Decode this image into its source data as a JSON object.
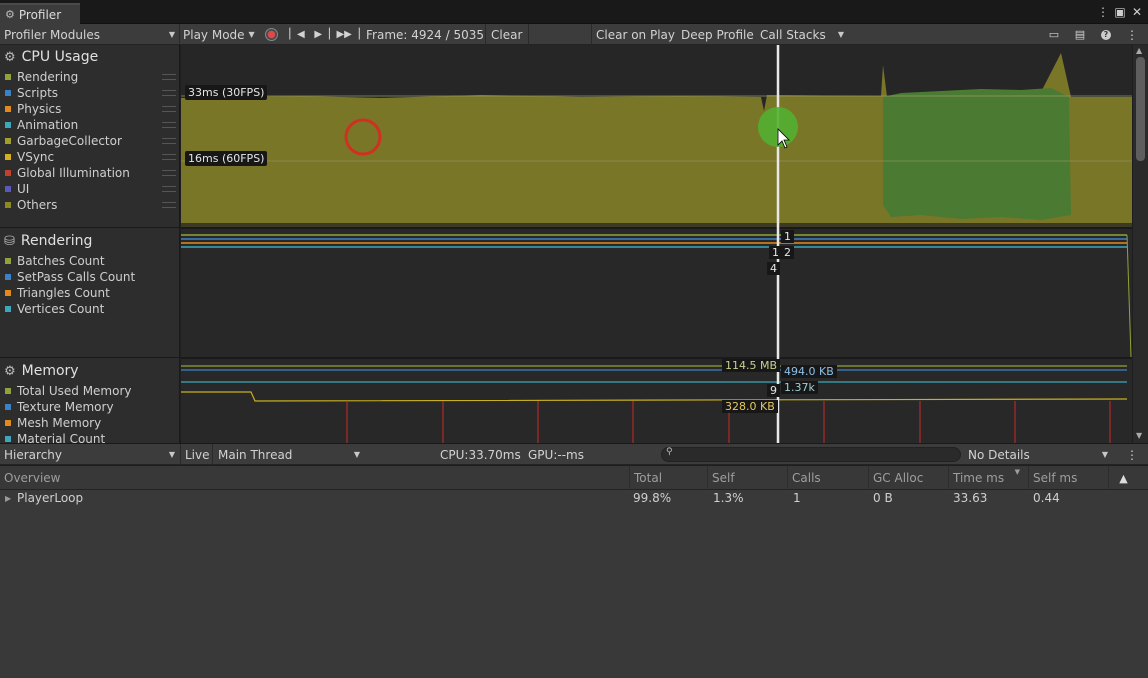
{
  "window": {
    "tab_title": "Profiler"
  },
  "toolbar": {
    "modules_label": "Profiler Modules",
    "play_mode_label": "Play Mode",
    "frame_label": "Frame: 4924 / 5035",
    "clear_label": "Clear",
    "clear_on_play_label": "Clear on Play",
    "deep_profile_label": "Deep Profile",
    "call_stacks_label": "Call Stacks"
  },
  "modules": {
    "cpu": {
      "title": "CPU Usage",
      "items": [
        {
          "label": "Rendering",
          "color": "#8fa33a"
        },
        {
          "label": "Scripts",
          "color": "#3b82c4"
        },
        {
          "label": "Physics",
          "color": "#e08a1e"
        },
        {
          "label": "Animation",
          "color": "#3aa8b8"
        },
        {
          "label": "GarbageCollector",
          "color": "#a0a028"
        },
        {
          "label": "VSync",
          "color": "#d4b020"
        },
        {
          "label": "Global Illumination",
          "color": "#c0402a"
        },
        {
          "label": "UI",
          "color": "#5a5ab8"
        },
        {
          "label": "Others",
          "color": "#8a8a20"
        }
      ]
    },
    "rendering": {
      "title": "Rendering",
      "items": [
        {
          "label": "Batches Count",
          "color": "#8fa33a"
        },
        {
          "label": "SetPass Calls Count",
          "color": "#3b82c4"
        },
        {
          "label": "Triangles Count",
          "color": "#e08a1e"
        },
        {
          "label": "Vertices Count",
          "color": "#3aa8b8"
        }
      ]
    },
    "memory": {
      "title": "Memory",
      "items": [
        {
          "label": "Total Used Memory",
          "color": "#8fa33a"
        },
        {
          "label": "Texture Memory",
          "color": "#3b82c4"
        },
        {
          "label": "Mesh Memory",
          "color": "#e08a1e"
        },
        {
          "label": "Material Count",
          "color": "#3aa8b8"
        }
      ]
    }
  },
  "charts": {
    "cpu_30fps_label": "33ms (30FPS)",
    "cpu_60fps_label": "16ms (60FPS)",
    "rendering_values": [
      "1",
      "1",
      "2",
      "4"
    ],
    "memory_values": {
      "total_used": "114.5 MB",
      "texture": "494.0 KB",
      "material_count": "9",
      "mesh_count": "1.37k",
      "mesh": "328.0 KB"
    }
  },
  "details": {
    "view_label": "Hierarchy",
    "live_label": "Live",
    "thread_label": "Main Thread",
    "cpu_time": "CPU:33.70ms",
    "gpu_time": "GPU:--ms",
    "details_label": "No Details"
  },
  "table": {
    "columns": [
      "Overview",
      "Total",
      "Self",
      "Calls",
      "GC Alloc",
      "Time ms",
      "Self ms"
    ],
    "rows": [
      {
        "name": "PlayerLoop",
        "total": "99.8%",
        "self": "1.3%",
        "calls": "1",
        "gc_alloc": "0 B",
        "time_ms": "33.63",
        "self_ms": "0.44"
      }
    ]
  }
}
